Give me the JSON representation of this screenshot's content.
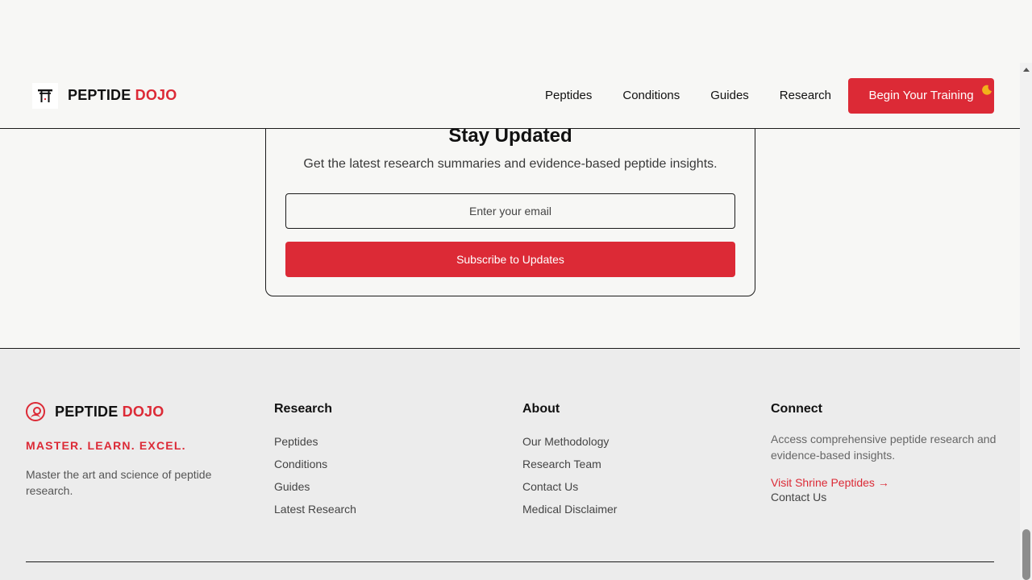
{
  "header": {
    "brand_main": "PEPTIDE",
    "brand_accent": "DOJO",
    "nav": [
      "Peptides",
      "Conditions",
      "Guides",
      "Research"
    ],
    "cta_label": "Begin Your Training"
  },
  "newsletter": {
    "title": "Stay Updated",
    "subtitle": "Get the latest research summaries and evidence-based peptide insights.",
    "email_placeholder": "Enter your email",
    "subscribe_label": "Subscribe to Updates"
  },
  "footer": {
    "brand_main": "PEPTIDE",
    "brand_accent": "DOJO",
    "tagline": "MASTER. LEARN. EXCEL.",
    "description": "Master the art and science of peptide research.",
    "research": {
      "heading": "Research",
      "links": [
        "Peptides",
        "Conditions",
        "Guides",
        "Latest Research"
      ]
    },
    "about": {
      "heading": "About",
      "links": [
        "Our Methodology",
        "Research Team",
        "Contact Us",
        "Medical Disclaimer"
      ]
    },
    "connect": {
      "heading": "Connect",
      "description": "Access comprehensive peptide research and evidence-based insights.",
      "visit_link": "Visit Shrine Peptides →",
      "contact_link": "Contact Us"
    }
  },
  "colors": {
    "accent": "#dc2a36",
    "background": "#f7f7f5",
    "footer_background": "#ececec"
  },
  "icons": {
    "header_logo": "torii-gate-icon",
    "footer_logo": "user-circle-icon",
    "theme_toggle": "moon-icon"
  }
}
